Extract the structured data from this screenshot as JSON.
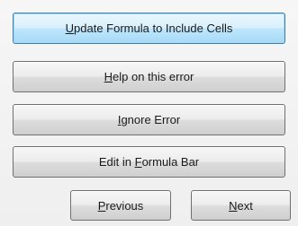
{
  "buttons": {
    "update_formula": {
      "pre": "",
      "key": "U",
      "post": "pdate Formula to Include Cells"
    },
    "help_error": {
      "pre": "",
      "key": "H",
      "post": "elp on this error"
    },
    "ignore_error": {
      "pre": "",
      "key": "I",
      "post": "gnore Error"
    },
    "edit_formula_bar": {
      "pre": "Edit in ",
      "key": "F",
      "post": "ormula Bar"
    },
    "previous": {
      "pre": "",
      "key": "P",
      "post": "revious"
    },
    "next": {
      "pre": "",
      "key": "N",
      "post": "ext"
    }
  },
  "colors": {
    "default_button_border": "#3c7fb1",
    "panel_background": "#f0f0f0"
  }
}
